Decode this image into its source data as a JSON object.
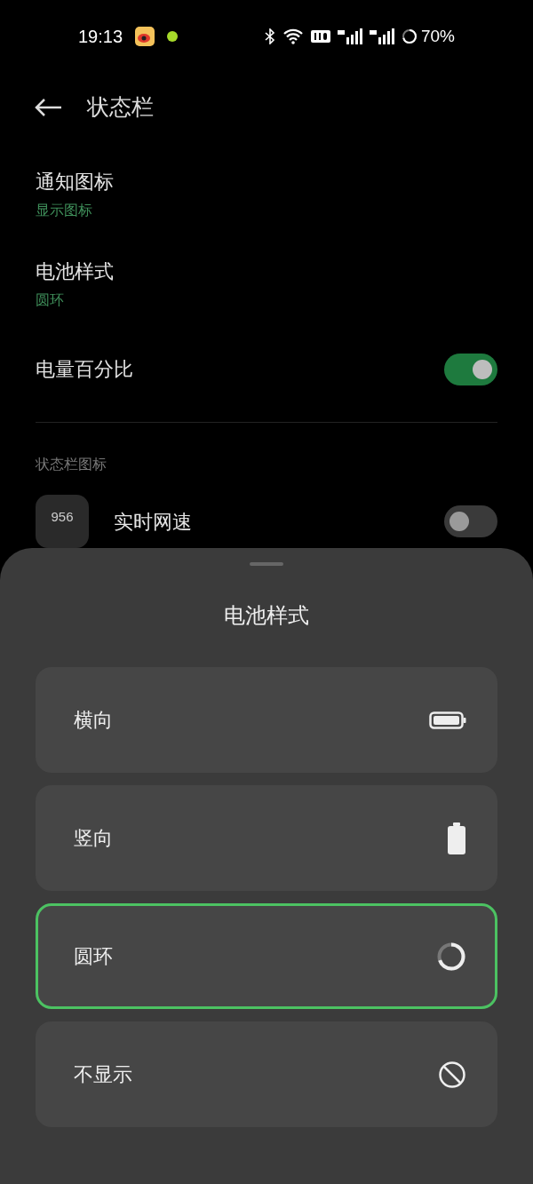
{
  "status_bar": {
    "time": "19:13",
    "battery": "70%"
  },
  "header": {
    "title": "状态栏"
  },
  "settings": [
    {
      "kind": "link",
      "title": "通知图标",
      "value": "显示图标"
    },
    {
      "kind": "link",
      "title": "电池样式",
      "value": "圆环"
    },
    {
      "kind": "toggle",
      "title": "电量百分比",
      "on": true
    }
  ],
  "section": {
    "title": "状态栏图标",
    "items": [
      {
        "badge": "956",
        "title": "实时网速",
        "on": false
      }
    ]
  },
  "sheet": {
    "title": "电池样式",
    "options": [
      {
        "kind": "horizontal",
        "label": "横向",
        "selected": false
      },
      {
        "kind": "vertical",
        "label": "竖向",
        "selected": false
      },
      {
        "kind": "ring",
        "label": "圆环",
        "selected": true
      },
      {
        "kind": "none",
        "label": "不显示",
        "selected": false
      }
    ]
  }
}
